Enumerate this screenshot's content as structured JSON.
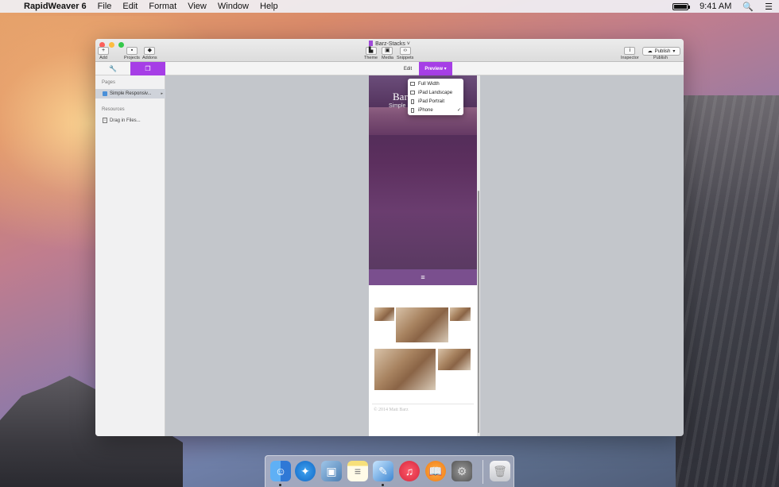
{
  "menubar": {
    "app_name": "RapidWeaver 6",
    "items": [
      "File",
      "Edit",
      "Format",
      "View",
      "Window",
      "Help"
    ],
    "time": "9:41 AM"
  },
  "window": {
    "title": "Barz-Stacks",
    "toolbar": {
      "add": "Add",
      "projects": "Projects",
      "addons": "Addons",
      "theme": "Theme",
      "media": "Media",
      "snippets": "Snippets",
      "inspector": "Inspector",
      "publish_button": "Publish",
      "publish_label": "Publish"
    },
    "tabs": {
      "edit": "Edit",
      "preview": "Preview"
    },
    "sidebar": {
      "pages_heading": "Pages",
      "page_item": "Simple Responsiv...",
      "resources_heading": "Resources",
      "drag_files": "Drag in Files..."
    },
    "preview_menu": {
      "items": [
        "Full Width",
        "iPad Landscape",
        "iPad Portrait",
        "iPhone"
      ],
      "checked": "iPhone"
    },
    "site": {
      "title": "Bar",
      "subtitle": "Simple",
      "footer": "© 2014 Matt Barz"
    }
  },
  "colors": {
    "accent": "#a63ee6",
    "hero": "#5c2f5e",
    "navbar": "#7a4f8e"
  },
  "dock": [
    "Finder",
    "Safari",
    "Preview",
    "Notes",
    "RapidWeaver",
    "iTunes",
    "iBooks",
    "System Preferences",
    "Trash"
  ]
}
